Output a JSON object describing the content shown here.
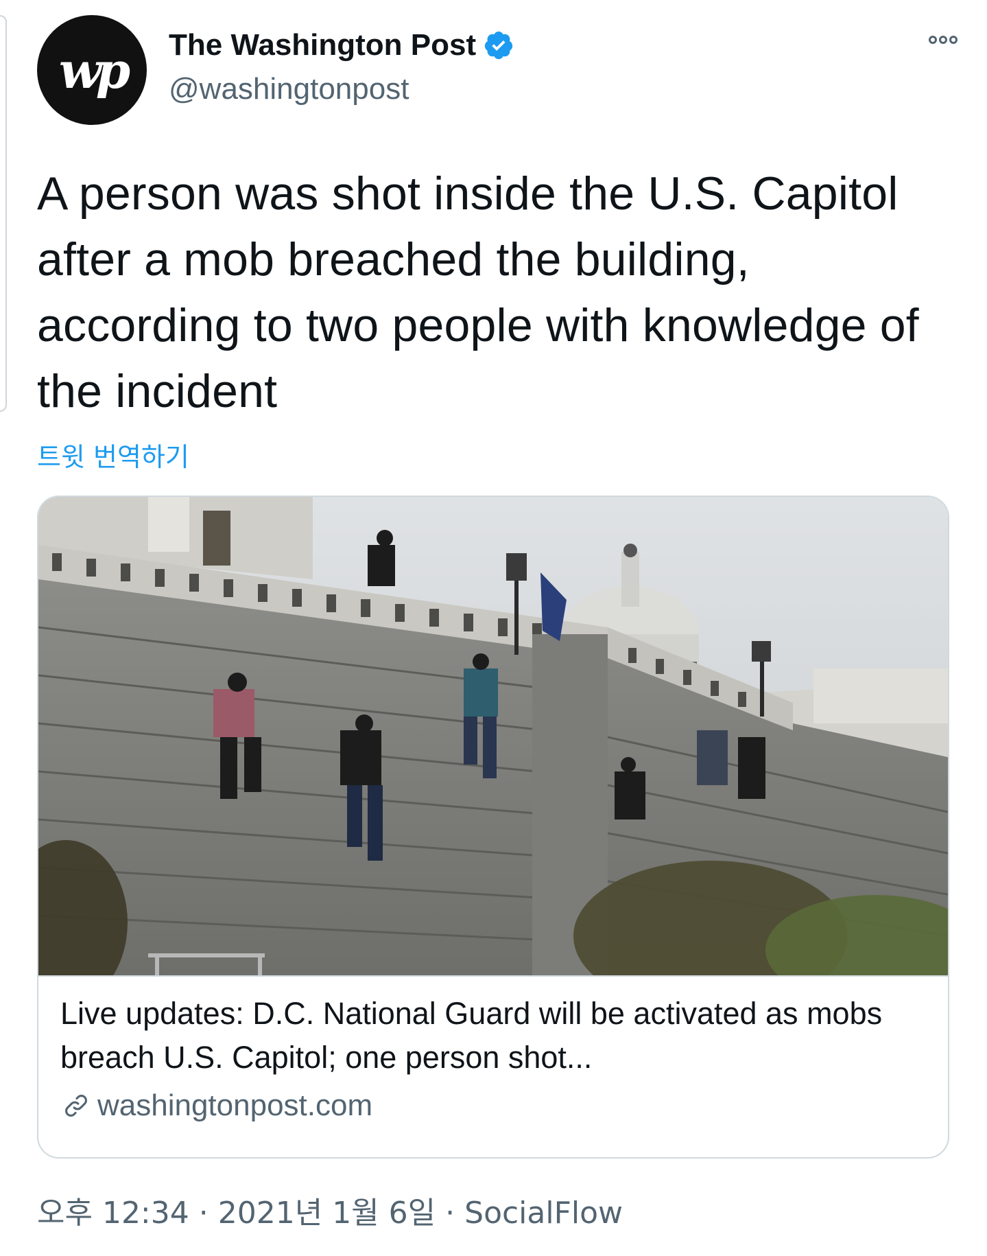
{
  "account": {
    "display_name": "The Washington Post",
    "handle": "@washingtonpost",
    "avatar_text": "wp",
    "verified_color": "#1d9bf0"
  },
  "tweet": {
    "text": "A person was shot inside the U.S. Capitol after a mob breached the building, according to two people with knowledge of the incident",
    "translate_label": "트윗 번역하기"
  },
  "link_card": {
    "title": "Live updates: D.C. National Guard will be activated as mobs breach U.S. Capitol; one person shot...",
    "domain": "washingtonpost.com"
  },
  "meta": {
    "time": "오후 12:34",
    "separator": "·",
    "date": "2021년 1월 6일",
    "source": "SocialFlow"
  },
  "colors": {
    "accent": "#1d9bf0",
    "secondary_text": "#536471",
    "primary_text": "#0f1419",
    "border": "#cfd9de"
  }
}
